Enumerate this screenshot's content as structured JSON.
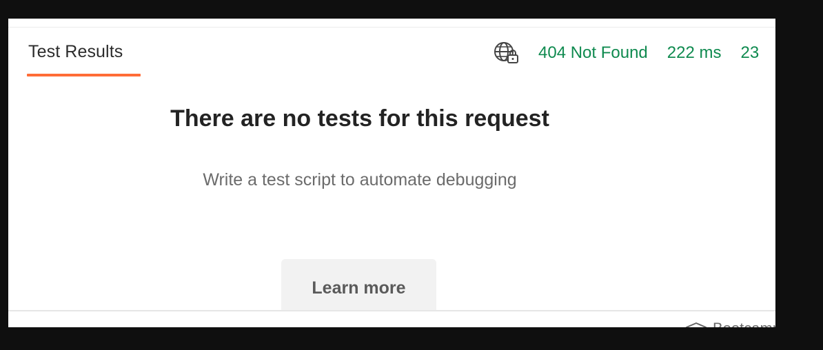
{
  "tabs": [
    {
      "label": "Test Results",
      "active": true
    }
  ],
  "response_meta": {
    "network_icon": "globe-lock-icon",
    "status": "404 Not Found",
    "time": "222 ms",
    "size_partial": "23"
  },
  "empty_state": {
    "title": "There are no tests for this request",
    "subtitle": "Write a test script to automate debugging",
    "button_label": "Learn more"
  },
  "footer": {
    "bootcamp_icon": "bootcamp-icon",
    "bootcamp_label": "Bootcamp"
  },
  "colors": {
    "accent": "#ff6c37",
    "status_ok_text": "#0f8a4f",
    "frame_background": "#0f0f0f"
  }
}
